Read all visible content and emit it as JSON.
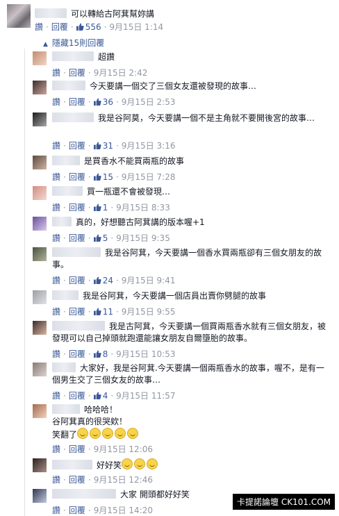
{
  "colors": {
    "link": "#3b5998",
    "meta": "#9197a3",
    "text": "#141823"
  },
  "top_comment": {
    "text": "可以轉給古阿萁幫妳講",
    "read": "讚",
    "reply": "回覆",
    "likes": "556",
    "date": "9月15日 1:14"
  },
  "hidden_replies": {
    "label": "隱藏15則回覆",
    "icon": "chevron-up-icon"
  },
  "replies": [
    {
      "text": "超讚",
      "likes": null,
      "date": "9月15日 2:42"
    },
    {
      "text": "今天要講一個交了三個女友還被發現的故事…",
      "likes": "36",
      "date": "9月15日 2:53"
    },
    {
      "text": "我是谷阿莫，今天要講一個不是主角就不要開後宮的故事…",
      "likes": "31",
      "date": "9月15日 3:16"
    },
    {
      "text": "是買香水不能買兩瓶的故事",
      "likes": "15",
      "date": "9月15日 7:28"
    },
    {
      "text": "買一瓶還不會被發現…",
      "likes": "1",
      "date": "9月15日 8:33"
    },
    {
      "text": "真的，好想聽古阿萁講的版本喔+1",
      "likes": "5",
      "date": "9月15日 9:35"
    },
    {
      "text": "我是谷阿萁，今天要講一個香水買兩瓶卻有三個女朋友的故事。",
      "likes": "24",
      "date": "9月15日 9:41"
    },
    {
      "text": "我是谷阿萁，今天要講一個店員出賣你劈腿的故事",
      "likes": "11",
      "date": "9月15日 9:55"
    },
    {
      "text": "我是古阿萁，今天要講一個買兩瓶香水就有三個女朋友，被發現可以自己掉頭就跑還能讓女朋友自爾墮胎的故事。",
      "likes": "8",
      "date": "9月15日 10:53"
    },
    {
      "text": "大家好，我是谷阿萁.今天要講一個兩瓶香水的故事，喔不，是有一個男生交了三個女友的故事…",
      "likes": "4",
      "date": "9月15日 11:57"
    },
    {
      "text": "哈哈哈！",
      "text2": "谷阿萁真的很哭欸！",
      "text3": "笑翻了",
      "likes": null,
      "date": "9月15日 12:06"
    },
    {
      "text": "好好笑",
      "likes": null,
      "date": "9月15日 12:46"
    },
    {
      "text": "大家 開頭都好好笑",
      "likes": null,
      "date": "9月15日 14:20"
    }
  ],
  "labels": {
    "read": "讚",
    "reply": "回覆"
  },
  "watermark": "卡提諾論壇 CK101.COM"
}
